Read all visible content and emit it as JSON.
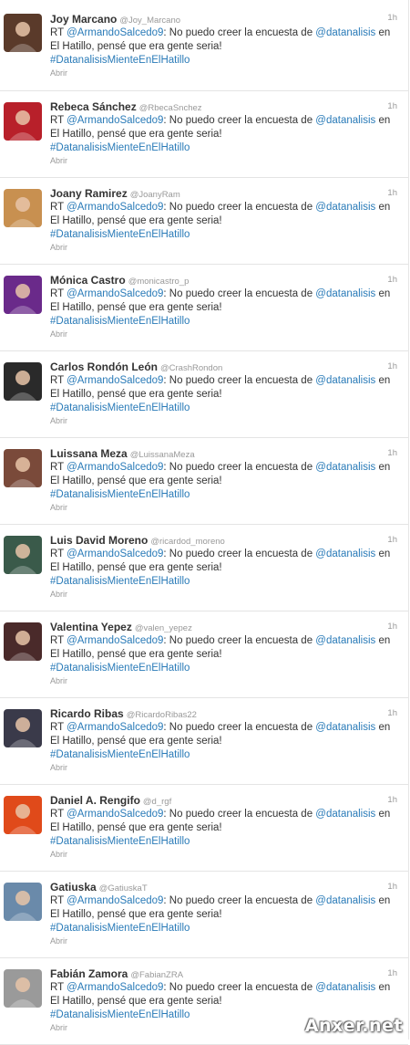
{
  "tweets": [
    {
      "name": "Joy Marcano",
      "handle": "@Joy_Marcano",
      "time": "1h",
      "rt": "RT",
      "mention_user": "@ArmandoSalcedo9",
      "body_1": ": No puedo creer la encuesta de ",
      "mention_org": "@datanalisis",
      "body_2": " en El Hatillo, pensé que era gente seria!",
      "hashtag": "#DatanalisisMienteEnElHatillo",
      "open_label": "Abrir",
      "avatar_color": "#5a3a2a"
    },
    {
      "name": "Rebeca Sánchez",
      "handle": "@RbecaSnchez",
      "time": "1h",
      "rt": "RT",
      "mention_user": "@ArmandoSalcedo9",
      "body_1": ": No puedo creer la encuesta de ",
      "mention_org": "@datanalisis",
      "body_2": " en El Hatillo, pensé que era gente seria!",
      "hashtag": "#DatanalisisMienteEnElHatillo",
      "open_label": "Abrir",
      "avatar_color": "#b8202a"
    },
    {
      "name": "Joany Ramirez",
      "handle": "@JoanyRam",
      "time": "1h",
      "rt": "RT",
      "mention_user": "@ArmandoSalcedo9",
      "body_1": ": No puedo creer la encuesta de ",
      "mention_org": "@datanalisis",
      "body_2": " en El Hatillo, pensé que era gente seria!",
      "hashtag": "#DatanalisisMienteEnElHatillo",
      "open_label": "Abrir",
      "avatar_color": "#c89050"
    },
    {
      "name": "Mónica Castro",
      "handle": "@monicastro_p",
      "time": "1h",
      "rt": "RT",
      "mention_user": "@ArmandoSalcedo9",
      "body_1": ": No puedo creer la encuesta de ",
      "mention_org": "@datanalisis",
      "body_2": " en El Hatillo, pensé que era gente seria!",
      "hashtag": "#DatanalisisMienteEnElHatillo",
      "open_label": "Abrir",
      "avatar_color": "#6a2a8a"
    },
    {
      "name": "Carlos Rondón León",
      "handle": "@CrashRondon",
      "time": "1h",
      "rt": "RT",
      "mention_user": "@ArmandoSalcedo9",
      "body_1": ": No puedo creer la encuesta de ",
      "mention_org": "@datanalisis",
      "body_2": " en El Hatillo, pensé que era gente seria!",
      "hashtag": "#DatanalisisMienteEnElHatillo",
      "open_label": "Abrir",
      "avatar_color": "#2a2a2a"
    },
    {
      "name": "Luissana Meza",
      "handle": "@LuissanaMeza",
      "time": "1h",
      "rt": "RT",
      "mention_user": "@ArmandoSalcedo9",
      "body_1": ": No puedo creer la encuesta de ",
      "mention_org": "@datanalisis",
      "body_2": " en El Hatillo, pensé que era gente seria!",
      "hashtag": "#DatanalisisMienteEnElHatillo",
      "open_label": "Abrir",
      "avatar_color": "#7a4a3a"
    },
    {
      "name": "Luis David Moreno",
      "handle": "@ricardod_moreno",
      "time": "1h",
      "rt": "RT",
      "mention_user": "@ArmandoSalcedo9",
      "body_1": ": No puedo creer la encuesta de ",
      "mention_org": "@datanalisis",
      "body_2": " en El Hatillo, pensé que era gente seria!",
      "hashtag": "#DatanalisisMienteEnElHatillo",
      "open_label": "Abrir",
      "avatar_color": "#3a5a4a"
    },
    {
      "name": "Valentina Yepez",
      "handle": "@valen_yepez",
      "time": "1h",
      "rt": "RT",
      "mention_user": "@ArmandoSalcedo9",
      "body_1": ": No puedo creer la encuesta de ",
      "mention_org": "@datanalisis",
      "body_2": " en El Hatillo, pensé que era gente seria!",
      "hashtag": "#DatanalisisMienteEnElHatillo",
      "open_label": "Abrir",
      "avatar_color": "#4a2a2a"
    },
    {
      "name": "Ricardo Ribas",
      "handle": "@RicardoRibas22",
      "time": "1h",
      "rt": "RT",
      "mention_user": "@ArmandoSalcedo9",
      "body_1": ": No puedo creer la encuesta de ",
      "mention_org": "@datanalisis",
      "body_2": " en El Hatillo, pensé que era gente seria!",
      "hashtag": "#DatanalisisMienteEnElHatillo",
      "open_label": "Abrir",
      "avatar_color": "#3a3a4a"
    },
    {
      "name": "Daniel A. Rengifo",
      "handle": "@d_rgf",
      "time": "1h",
      "rt": "RT",
      "mention_user": "@ArmandoSalcedo9",
      "body_1": ": No puedo creer la encuesta de ",
      "mention_org": "@datanalisis",
      "body_2": " en El Hatillo, pensé que era gente seria!",
      "hashtag": "#DatanalisisMienteEnElHatillo",
      "open_label": "Abrir",
      "avatar_color": "#e04a1a"
    },
    {
      "name": "Gatiuska",
      "handle": "@GatiuskaT",
      "time": "1h",
      "rt": "RT",
      "mention_user": "@ArmandoSalcedo9",
      "body_1": ": No puedo creer la encuesta de ",
      "mention_org": "@datanalisis",
      "body_2": " en El Hatillo, pensé que era gente seria!",
      "hashtag": "#DatanalisisMienteEnElHatillo",
      "open_label": "Abrir",
      "avatar_color": "#6a8aaa"
    },
    {
      "name": "Fabián Zamora",
      "handle": "@FabianZRA",
      "time": "1h",
      "rt": "RT",
      "mention_user": "@ArmandoSalcedo9",
      "body_1": ": No puedo creer la encuesta de ",
      "mention_org": "@datanalisis",
      "body_2": " en El Hatillo, pensé que era gente seria!",
      "hashtag": "#DatanalisisMienteEnElHatillo",
      "open_label": "Abrir",
      "avatar_color": "#9a9a9a"
    }
  ],
  "watermark": "Anxer.net",
  "colors": {
    "link": "#2a7bb8",
    "muted": "#999999",
    "text": "#333333"
  }
}
